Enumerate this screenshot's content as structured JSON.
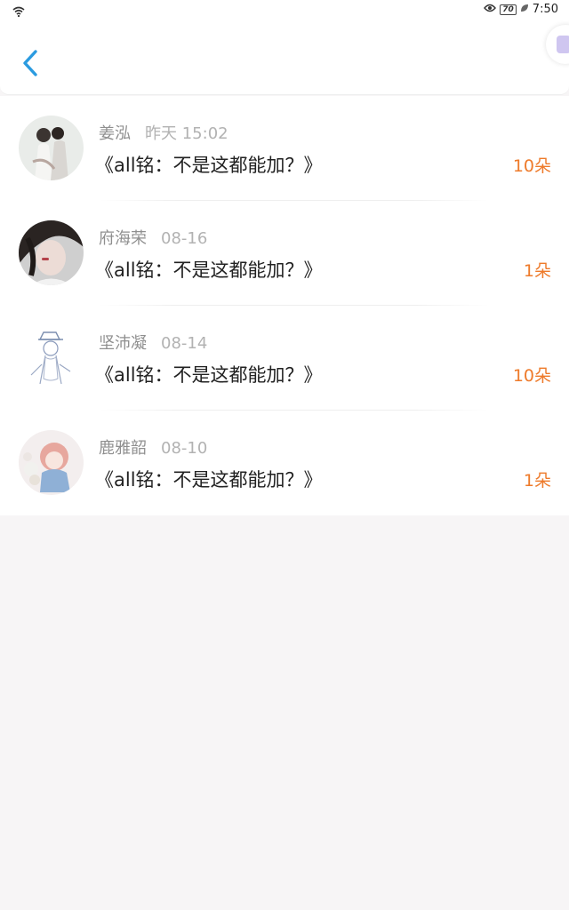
{
  "status_bar": {
    "battery": "70",
    "time": "7:50"
  },
  "colors": {
    "accent_back": "#2b9be0",
    "count": "#ee7a2a"
  },
  "entries": [
    {
      "name": "姜泓",
      "date": "昨天 15:02",
      "title": "《all铭：不是这都能加？》",
      "count": "10朵"
    },
    {
      "name": "府海荣",
      "date": "08-16",
      "title": "《all铭：不是这都能加？》",
      "count": "1朵"
    },
    {
      "name": "坚沛凝",
      "date": "08-14",
      "title": "《all铭：不是这都能加？》",
      "count": "10朵"
    },
    {
      "name": "鹿雅韶",
      "date": "08-10",
      "title": "《all铭：不是这都能加？》",
      "count": "1朵"
    }
  ]
}
